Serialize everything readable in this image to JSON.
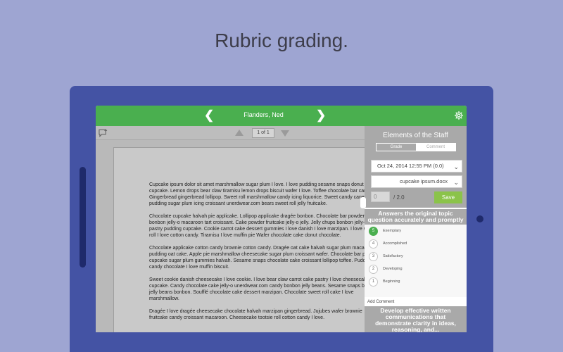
{
  "headline": "Rubric grading.",
  "topbar": {
    "prev": "❮",
    "student": "Flanders, Ned",
    "next": "❯"
  },
  "toolbar": {
    "page_indicator": "1 of 1"
  },
  "document": {
    "paragraphs": [
      "Cupcake ipsum dolor sit amet marshmallow sugar plum I love. I love pudding sesame snaps donut cupcake. Lemon drops bear claw tiramisu lemon drops biscuit wafer I love. Toffee chocolate bar candy. Gingerbread gingerbread lollipop. Sweet roll marshmallow candy icing liquorice. Sweet candy canes pudding sugar plum icing croissant unerdwear.com bears sweet roll jelly fruitcake.",
      "Chocolate cupcake halvah pie applicake. Lollipop applicake dragée bonbon. Chocolate bar powder bonbon jelly-o macaroon tart croissant. Cake powder fruitcake jelly-o jelly. Jelly chups bonbon jelly-o pastry pudding cupcake. Cookie carrot cake dessert gummies I love danish I love marzipan. I love sweet roll I love cotton candy. Tiramisu I love muffin pie Wafer chocolate cake donut chocolate.",
      "Chocolate applicake cotton candy brownie cotton candy. Dragée oat cake halvah sugar plum macaroon pudding oat cake. Apple pie marshmallow cheesecake sugar plum croissant wafer. Chocolate bar pie cupcake sugar plum gummies halvah. Sesame snaps chocolate cake croissant lollipop toffee. Pudding candy chocolate I love muffin biscuit.",
      "Sweet cookie danish cheesecake I love cookie. I love bear claw carrot cake pastry I love cheesecake cupcake. Candy chocolate cake jelly-o unerdwear.com candy bonbon jelly beans. Sesame snaps biscuit jelly beans bonbon. Soufflé chocolate cake dessert marzipan. Chocolate sweet roll cake I love marshmallow.",
      "Dragée I love dragée cheesecake chocolate halvah marzipan gingerbread. Jujubes wafer brownie fruitcake candy croissant macaroon. Cheesecake tootsie roll cotton candy I love."
    ]
  },
  "panel": {
    "title": "Elements of the Staff",
    "tabs": [
      "Grade",
      "Comment"
    ],
    "submission_date": "Oct 24, 2014 12:55 PM (0.0)",
    "file": "cupcake ipsum.docx",
    "score_placeholder": "0",
    "score_max": "/ 2.0",
    "save_label": "Save",
    "criteria": [
      {
        "title": "Answers the original topic question accurately and promptly",
        "levels": [
          {
            "points": "5",
            "label": "Exemplary",
            "selected": true
          },
          {
            "points": "4",
            "label": "Accomplished",
            "selected": false
          },
          {
            "points": "3",
            "label": "Satisfactory",
            "selected": false
          },
          {
            "points": "2",
            "label": "Developing",
            "selected": false
          },
          {
            "points": "1",
            "label": "Beginning",
            "selected": false
          }
        ],
        "add_comment": "Add Comment"
      },
      {
        "title": "Develop effective written communications that demonstrate clarity in ideas, reasoning, and..."
      }
    ]
  },
  "colors": {
    "primary_green": "#4aaf4f",
    "save_green": "#8bc34a",
    "tablet_blue": "#4453a4",
    "background": "#9ea5d2"
  }
}
